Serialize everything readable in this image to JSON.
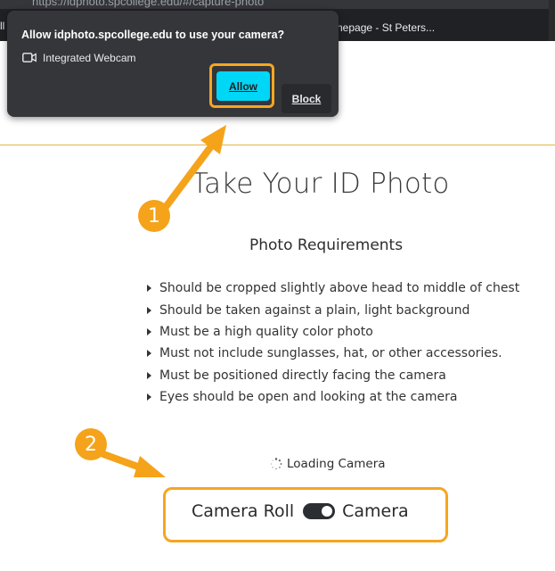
{
  "browser": {
    "url": "https://idphoto.spcollege.edu/#/capture-photo",
    "left_tab_fragment": "ll",
    "bookmark": "nepage - St Peters..."
  },
  "permission_popup": {
    "title": "Allow idphoto.spcollege.edu to use your camera?",
    "device_icon": "webcam-icon",
    "device_label": "Integrated Webcam",
    "allow_label": "Allow",
    "block_label": "Block",
    "allow_color": "#00d6f5"
  },
  "page": {
    "title": "Take Your ID Photo",
    "requirements_heading": "Photo Requirements",
    "requirements": [
      "Should be cropped slightly above head to middle of chest",
      "Should be taken against a plain, light background",
      "Must be a high quality color photo",
      "Must not include sunglasses, hat, or other accessories.",
      "Must be positioned directly facing the camera",
      "Eyes should be open and looking at the camera"
    ],
    "loading_text": "Loading Camera",
    "toggle": {
      "left_label": "Camera Roll",
      "right_label": "Camera",
      "state": "Camera"
    },
    "divider_color": "#e2b548"
  },
  "annotations": {
    "step1": "1",
    "step2": "2",
    "highlight_color": "#f5a623"
  }
}
